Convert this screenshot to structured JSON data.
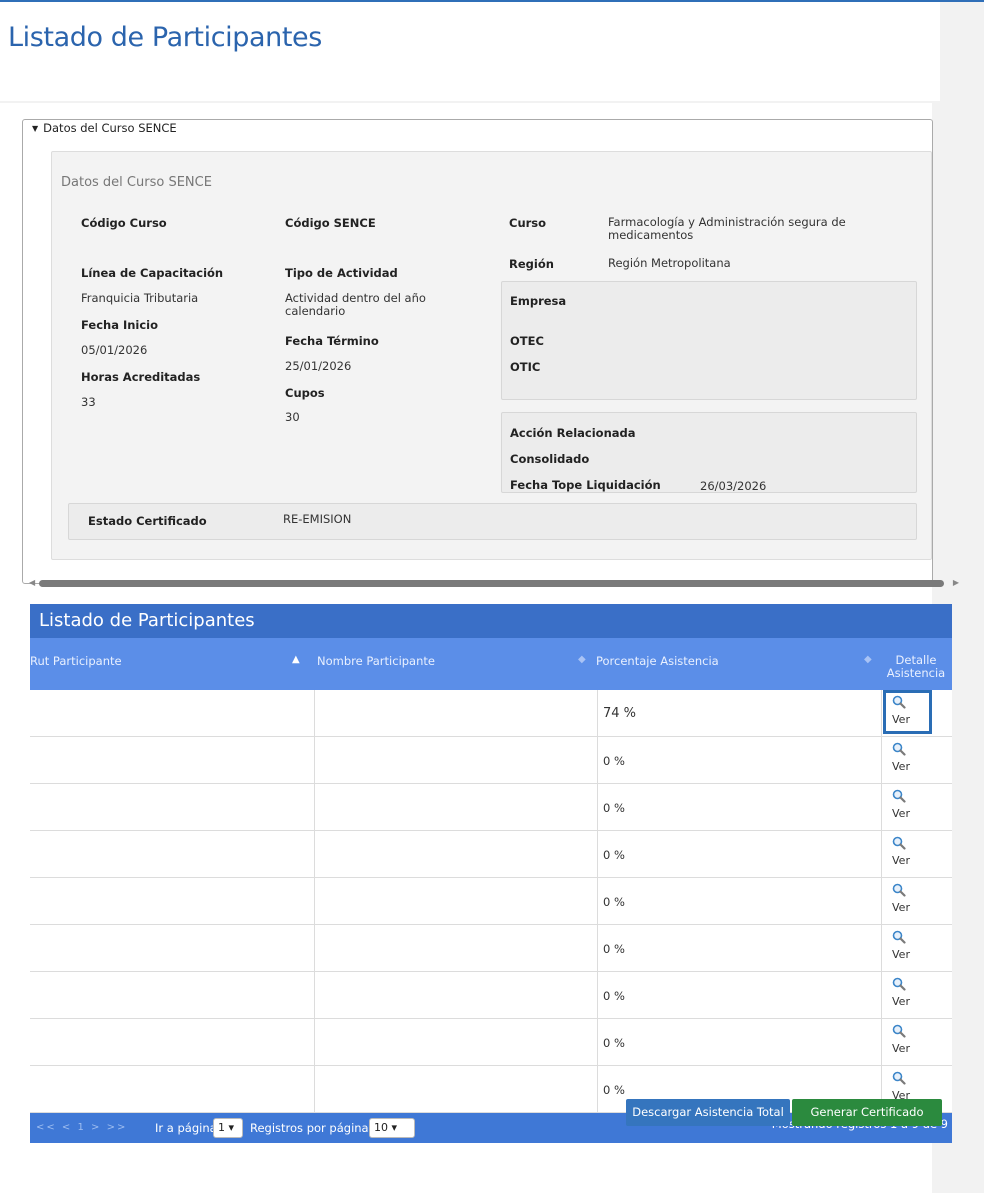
{
  "page": {
    "title": "Listado de Participantes"
  },
  "course": {
    "legend": "Datos del Curso SENCE",
    "panel_title": "Datos del Curso SENCE",
    "codigo_curso_label": "Código Curso",
    "codigo_sence_label": "Código SENCE",
    "curso_label": "Curso",
    "curso_value": "Farmacología y Administración segura de medicamentos",
    "linea_label": "Línea de Capacitación",
    "linea_value": "Franquicia Tributaria",
    "tipo_label": "Tipo de Actividad",
    "tipo_value": "Actividad dentro del año calendario",
    "region_label": "Región",
    "region_value": "Región Metropolitana",
    "fecha_inicio_label": "Fecha Inicio",
    "fecha_inicio_value": "05/01/2026",
    "fecha_termino_label": "Fecha Término",
    "fecha_termino_value": "25/01/2026",
    "horas_label": "Horas Acreditadas",
    "horas_value": "33",
    "cupos_label": "Cupos",
    "cupos_value": "30",
    "empresa_label": "Empresa",
    "otec_label": "OTEC",
    "otic_label": "OTIC",
    "accion_label": "Acción Relacionada",
    "consolidado_label": "Consolidado",
    "fecha_tope_label": "Fecha Tope Liquidación",
    "fecha_tope_value": "26/03/2026",
    "estado_label": "Estado Certificado",
    "estado_value": "RE-EMISION"
  },
  "grid": {
    "caption": "Listado de Participantes",
    "columns": [
      "Rut Participante",
      "Nombre Participante",
      "Porcentaje Asistencia",
      "Detalle Asistencia"
    ],
    "rows": [
      {
        "pct": "74 %",
        "ver": "Ver"
      },
      {
        "pct": "0 %",
        "ver": "Ver"
      },
      {
        "pct": "0 %",
        "ver": "Ver"
      },
      {
        "pct": "0 %",
        "ver": "Ver"
      },
      {
        "pct": "0 %",
        "ver": "Ver"
      },
      {
        "pct": "0 %",
        "ver": "Ver"
      },
      {
        "pct": "0 %",
        "ver": "Ver"
      },
      {
        "pct": "0 %",
        "ver": "Ver"
      },
      {
        "pct": "0 %",
        "ver": "Ver"
      }
    ],
    "pager": {
      "navs": "<<  <  1  >  >>",
      "go_label": "Ir a página:",
      "page_value": "1",
      "per_page_label": "Registros por página:",
      "per_page_value": "10",
      "showing": "Mostrando registros 1 a 9 de 9"
    }
  },
  "buttons": {
    "download": "Descargar Asistencia Total",
    "generate": "Generar Certificado"
  },
  "colors": {
    "title": "#2b64ad",
    "grid_caption": "#3a6fc7",
    "grid_header": "#5b8ee8",
    "btn_download": "#3575be",
    "btn_generate": "#2b8a3e"
  }
}
